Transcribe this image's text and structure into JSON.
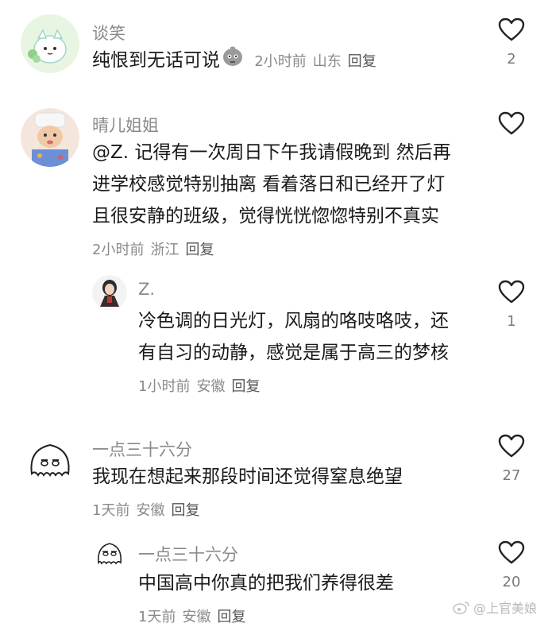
{
  "comments": [
    {
      "username": "谈笑",
      "text_lines": [
        "纯恨到无话可说"
      ],
      "time": "2小时前",
      "location": "山东",
      "reply_label": "回复",
      "likes": "2"
    },
    {
      "username": "晴儿姐姐",
      "text_lines": [
        "@Z. 记得有一次周日下午我请假晚到 然后再",
        "进学校感觉特别抽离 看着落日和已经开了灯",
        "且很安静的班级，觉得恍恍惚惚特别不真实"
      ],
      "time": "2小时前",
      "location": "浙江",
      "reply_label": "回复",
      "likes": ""
    },
    {
      "username": "Z.",
      "text_lines": [
        "冷色调的日光灯，风扇的咯吱咯吱，还",
        "有自习的动静，感觉是属于高三的梦核"
      ],
      "time": "1小时前",
      "location": "安徽",
      "reply_label": "回复",
      "likes": "1"
    },
    {
      "username": "一点三十六分",
      "text_lines": [
        "我现在想起来那段时间还觉得窒息绝望"
      ],
      "time": "1天前",
      "location": "安徽",
      "reply_label": "回复",
      "likes": "27"
    },
    {
      "username": "一点三十六分",
      "text_lines": [
        "中国高中你真的把我们养得很差"
      ],
      "time": "1天前",
      "location": "安徽",
      "reply_label": "回复",
      "likes": "20"
    }
  ],
  "watermark": "@上官美娘"
}
